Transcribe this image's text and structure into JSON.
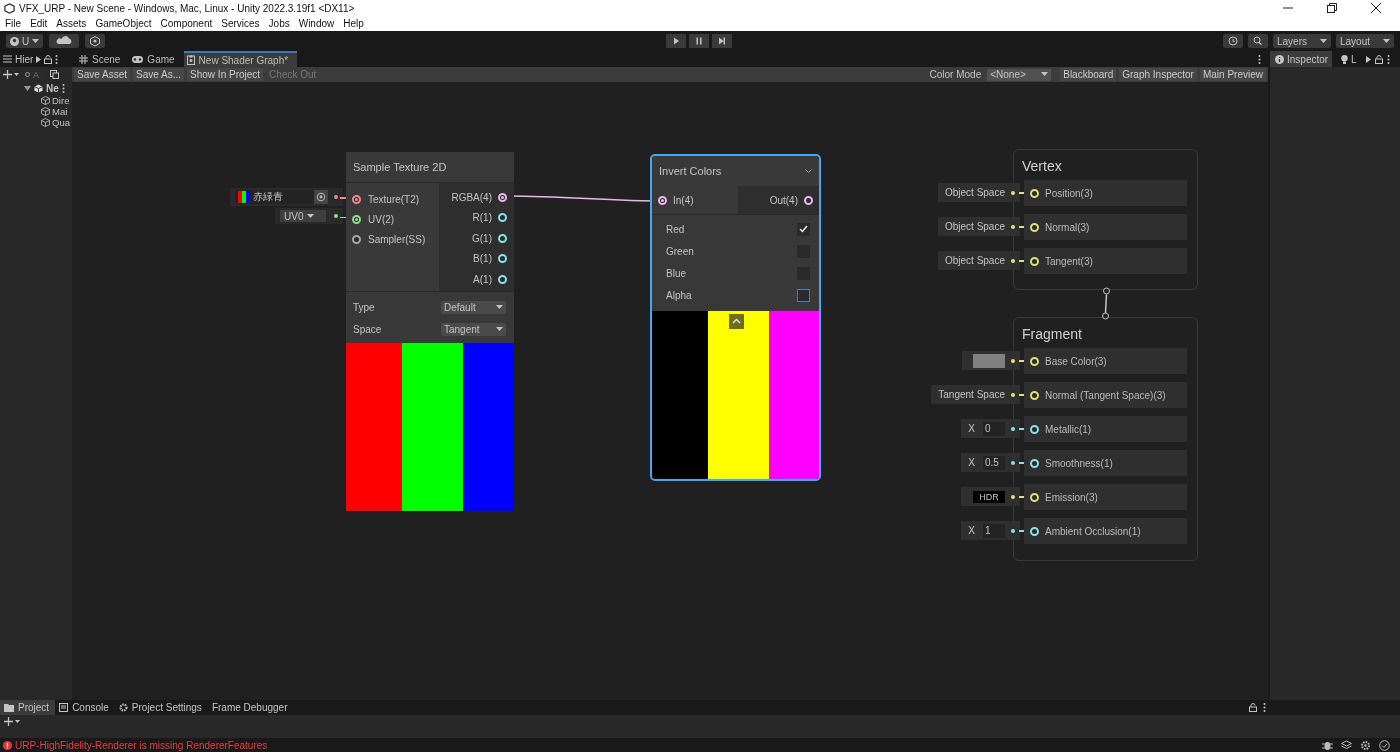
{
  "window": {
    "title": "VFX_URP - New Scene - Windows, Mac, Linux - Unity 2022.3.19f1 <DX11>"
  },
  "menu": [
    "File",
    "Edit",
    "Assets",
    "GameObject",
    "Component",
    "Services",
    "Jobs",
    "Window",
    "Help"
  ],
  "toolbar": {
    "account": "U",
    "layers": "Layers",
    "layout": "Layout"
  },
  "hierarchy": {
    "title": "Hier",
    "search": "A",
    "scene": "Ne",
    "items": [
      "Dire",
      "Mai",
      "Qua"
    ]
  },
  "tabs": [
    {
      "label": "Scene",
      "selected": false
    },
    {
      "label": "Game",
      "selected": false
    },
    {
      "label": "New Shader Graph*",
      "selected": true
    }
  ],
  "graph_toolbar": {
    "buttons": [
      {
        "label": "Save Asset",
        "disabled": false
      },
      {
        "label": "Save As...",
        "disabled": false
      },
      {
        "label": "Show In Project",
        "disabled": false
      },
      {
        "label": "Check Out",
        "disabled": true
      }
    ],
    "color_mode_label": "Color Mode",
    "color_mode": "<None>",
    "right_buttons": [
      "Blackboard",
      "Graph Inspector",
      "Main Preview"
    ]
  },
  "inspector": {
    "tabs": [
      {
        "label": "Inspector",
        "selected": true
      },
      {
        "label": "L",
        "selected": false
      }
    ]
  },
  "sample_texture": {
    "title": "Sample Texture 2D",
    "texture": "赤緑青",
    "uv": "UV0",
    "inputs": [
      {
        "label": "Texture(T2)",
        "color": "#f08a8a",
        "connected": true
      },
      {
        "label": "UV(2)",
        "color": "#8ee08e",
        "connected": true
      },
      {
        "label": "Sampler(SS)",
        "color": "#a8a8a8",
        "connected": false
      }
    ],
    "outputs": [
      {
        "label": "RGBA(4)",
        "color": "#e8b6e8",
        "connected": true
      },
      {
        "label": "R(1)",
        "color": "#84e4e7",
        "connected": false
      },
      {
        "label": "G(1)",
        "color": "#84e4e7",
        "connected": false
      },
      {
        "label": "B(1)",
        "color": "#84e4e7",
        "connected": false
      },
      {
        "label": "A(1)",
        "color": "#84e4e7",
        "connected": false
      }
    ],
    "settings": [
      {
        "label": "Type",
        "value": "Default"
      },
      {
        "label": "Space",
        "value": "Tangent"
      }
    ]
  },
  "invert": {
    "title": "Invert Colors",
    "selected": true,
    "input": "In(4)",
    "output": "Out(4)",
    "input_connected": true,
    "output_connected": false,
    "channels": [
      {
        "label": "Red",
        "checked": true,
        "focused": false
      },
      {
        "label": "Green",
        "checked": false,
        "focused": false
      },
      {
        "label": "Blue",
        "checked": false,
        "focused": false
      },
      {
        "label": "Alpha",
        "checked": false,
        "focused": true
      }
    ]
  },
  "vertex": {
    "title": "Vertex",
    "ports": [
      {
        "label": "Position(3)",
        "kind": "space",
        "value": "Object Space",
        "color": "#e0e07a"
      },
      {
        "label": "Normal(3)",
        "kind": "space",
        "value": "Object Space",
        "color": "#e0e07a"
      },
      {
        "label": "Tangent(3)",
        "kind": "space",
        "value": "Object Space",
        "color": "#e0e07a"
      }
    ]
  },
  "fragment": {
    "title": "Fragment",
    "ports": [
      {
        "label": "Base Color(3)",
        "kind": "color",
        "color": "#e0e07a"
      },
      {
        "label": "Normal (Tangent Space)(3)",
        "kind": "space",
        "value": "Tangent Space",
        "color": "#e0e07a"
      },
      {
        "label": "Metallic(1)",
        "kind": "float",
        "axis": "X",
        "value": "0",
        "color": "#84e4e7"
      },
      {
        "label": "Smoothness(1)",
        "kind": "float",
        "axis": "X",
        "value": "0.5",
        "color": "#84e4e7"
      },
      {
        "label": "Emission(3)",
        "kind": "hdr",
        "value": "HDR",
        "color": "#e0e07a"
      },
      {
        "label": "Ambient Occlusion(1)",
        "kind": "float",
        "axis": "X",
        "value": "1",
        "color": "#84e4e7"
      }
    ]
  },
  "bottom_tabs": [
    {
      "label": "Project",
      "selected": true
    },
    {
      "label": "Console",
      "selected": false
    },
    {
      "label": "Project Settings",
      "selected": false
    },
    {
      "label": "Frame Debugger",
      "selected": false
    }
  ],
  "status_bar": {
    "message": "URP-HighFidelity-Renderer is missing RendererFeatures"
  }
}
